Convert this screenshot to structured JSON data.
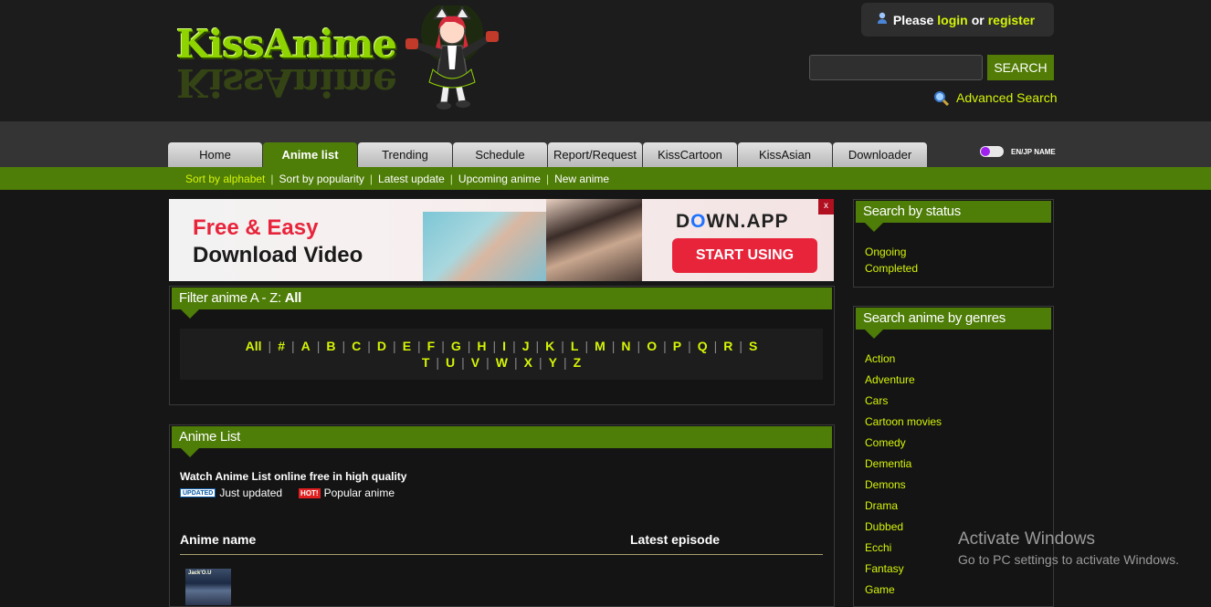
{
  "header": {
    "logo_text": "KissAnime",
    "login": {
      "prefix": "Please",
      "login_label": "login",
      "or": "or",
      "register_label": "register"
    },
    "search": {
      "placeholder": "",
      "button_label": "SEARCH"
    },
    "advanced_search_label": "Advanced Search"
  },
  "nav": {
    "tabs": [
      "Home",
      "Anime list",
      "Trending",
      "Schedule",
      "Report/Request",
      "KissCartoon",
      "KissAsian",
      "Downloader"
    ],
    "active_tab": "Anime list",
    "lang_toggle_label": "EN/JP NAME"
  },
  "subnav": {
    "items": [
      "Sort by alphabet",
      "Sort by popularity",
      "Latest update",
      "Upcoming anime",
      "New anime"
    ],
    "active": "Sort by alphabet"
  },
  "ad": {
    "line1": "Free & Easy",
    "line2": "Download Video",
    "brand_pre": "D",
    "brand_o": "O",
    "brand_post": "WN.APP",
    "cta": "START USING",
    "close_label": "x"
  },
  "filter": {
    "title_prefix": "Filter anime A - Z: ",
    "title_value": "All",
    "letters_row1": [
      "All",
      "#",
      "A",
      "B",
      "C",
      "D",
      "E",
      "F",
      "G",
      "H",
      "I",
      "J",
      "K",
      "L",
      "M",
      "N",
      "O",
      "P",
      "Q",
      "R",
      "S"
    ],
    "letters_row2": [
      "T",
      "U",
      "V",
      "W",
      "X",
      "Y",
      "Z"
    ]
  },
  "anime_list": {
    "title": "Anime List",
    "intro": "Watch Anime List online free in high quality",
    "legend_updated_badge": "UPDATED",
    "legend_updated_text": "Just updated",
    "legend_hot_badge": "HOT!",
    "legend_hot_text": "Popular anime",
    "col_name": "Anime name",
    "col_latest": "Latest episode",
    "thumb_text": "Jack'O.U"
  },
  "status": {
    "title": "Search by status",
    "items": [
      "Ongoing",
      "Completed"
    ]
  },
  "genres": {
    "title": "Search anime by genres",
    "items": [
      "Action",
      "Adventure",
      "Cars",
      "Cartoon movies",
      "Comedy",
      "Dementia",
      "Demons",
      "Drama",
      "Dubbed",
      "Ecchi",
      "Fantasy",
      "Game"
    ]
  },
  "watermark": {
    "line1": "Activate Windows",
    "line2": "Go to PC settings to activate Windows."
  },
  "colors": {
    "accent_green": "#4e7d08",
    "link_yellow": "#d5f406",
    "ad_red": "#e8243b"
  }
}
